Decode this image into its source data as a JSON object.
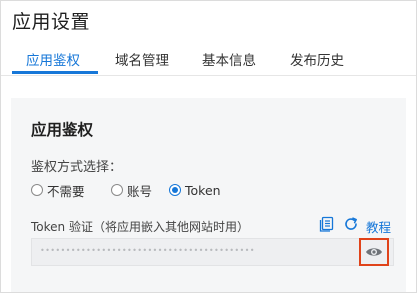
{
  "page_title": "应用设置",
  "tabs": [
    {
      "label": "应用鉴权",
      "active": true
    },
    {
      "label": "域名管理",
      "active": false
    },
    {
      "label": "基本信息",
      "active": false
    },
    {
      "label": "发布历史",
      "active": false
    }
  ],
  "auth_section": {
    "title": "应用鉴权",
    "method_label": "鉴权方式选择：",
    "options": [
      {
        "label": "不需要",
        "checked": false
      },
      {
        "label": "账号",
        "checked": false
      },
      {
        "label": "Token",
        "checked": true
      }
    ],
    "token_label": "Token 验证（将应用嵌入其他网站时用）",
    "copy_icon": "copy-icon",
    "refresh_icon": "refresh-icon",
    "tutorial_link": "教程",
    "token_value": "••••••••••••••••••••••••••••••••••••••••••",
    "eye_icon": "eye-icon"
  },
  "colors": {
    "accent": "#1677d8",
    "highlight_border": "#e0431a",
    "panel_bg": "#f5f6f7"
  }
}
